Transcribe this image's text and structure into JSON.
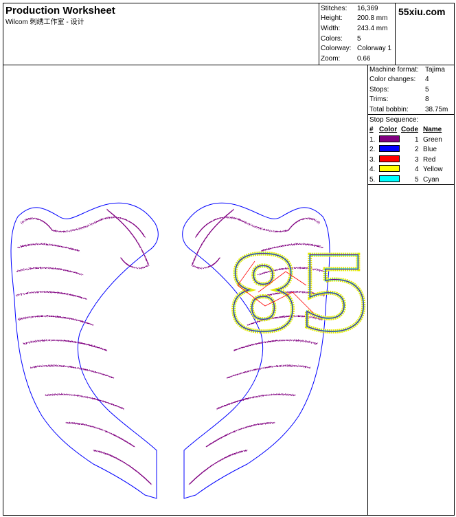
{
  "header": {
    "title": "Production Worksheet",
    "subtitle": "Wilcom 刺绣工作室 - 设计",
    "brand": "55xiu.com"
  },
  "stats": [
    {
      "label": "Stitches:",
      "value": "16,369"
    },
    {
      "label": "Height:",
      "value": "200.8 mm"
    },
    {
      "label": "Width:",
      "value": "243.4 mm"
    },
    {
      "label": "Colors:",
      "value": "5"
    },
    {
      "label": "Colorway:",
      "value": "Colorway 1"
    },
    {
      "label": "Zoom:",
      "value": "0.66"
    }
  ],
  "machine": [
    {
      "label": "Machine format:",
      "value": "Tajima"
    },
    {
      "label": "Color changes:",
      "value": "4"
    },
    {
      "label": "Stops:",
      "value": "5"
    },
    {
      "label": "Trims:",
      "value": "8"
    },
    {
      "label": "Total bobbin:",
      "value": "38.75m"
    }
  ],
  "stop_sequence": {
    "title": "Stop Sequence:",
    "headers": [
      "#",
      "Color",
      "Code",
      "Name"
    ],
    "rows": [
      {
        "num": "1.",
        "code": "1",
        "name": "Green",
        "color": "#800080"
      },
      {
        "num": "2.",
        "code": "2",
        "name": "Blue",
        "color": "#0000ff"
      },
      {
        "num": "3.",
        "code": "3",
        "name": "Red",
        "color": "#ff0000"
      },
      {
        "num": "4.",
        "code": "4",
        "name": "Yellow",
        "color": "#ffff00"
      },
      {
        "num": "5.",
        "code": "5",
        "name": "Cyan",
        "color": "#00ffff"
      }
    ]
  },
  "design": {
    "text": "85",
    "colors": {
      "stitch": "#800080",
      "outline": "#0000ff",
      "run": "#ff0000",
      "yellow": "#e8e800",
      "cyan": "#00e0e0"
    }
  }
}
